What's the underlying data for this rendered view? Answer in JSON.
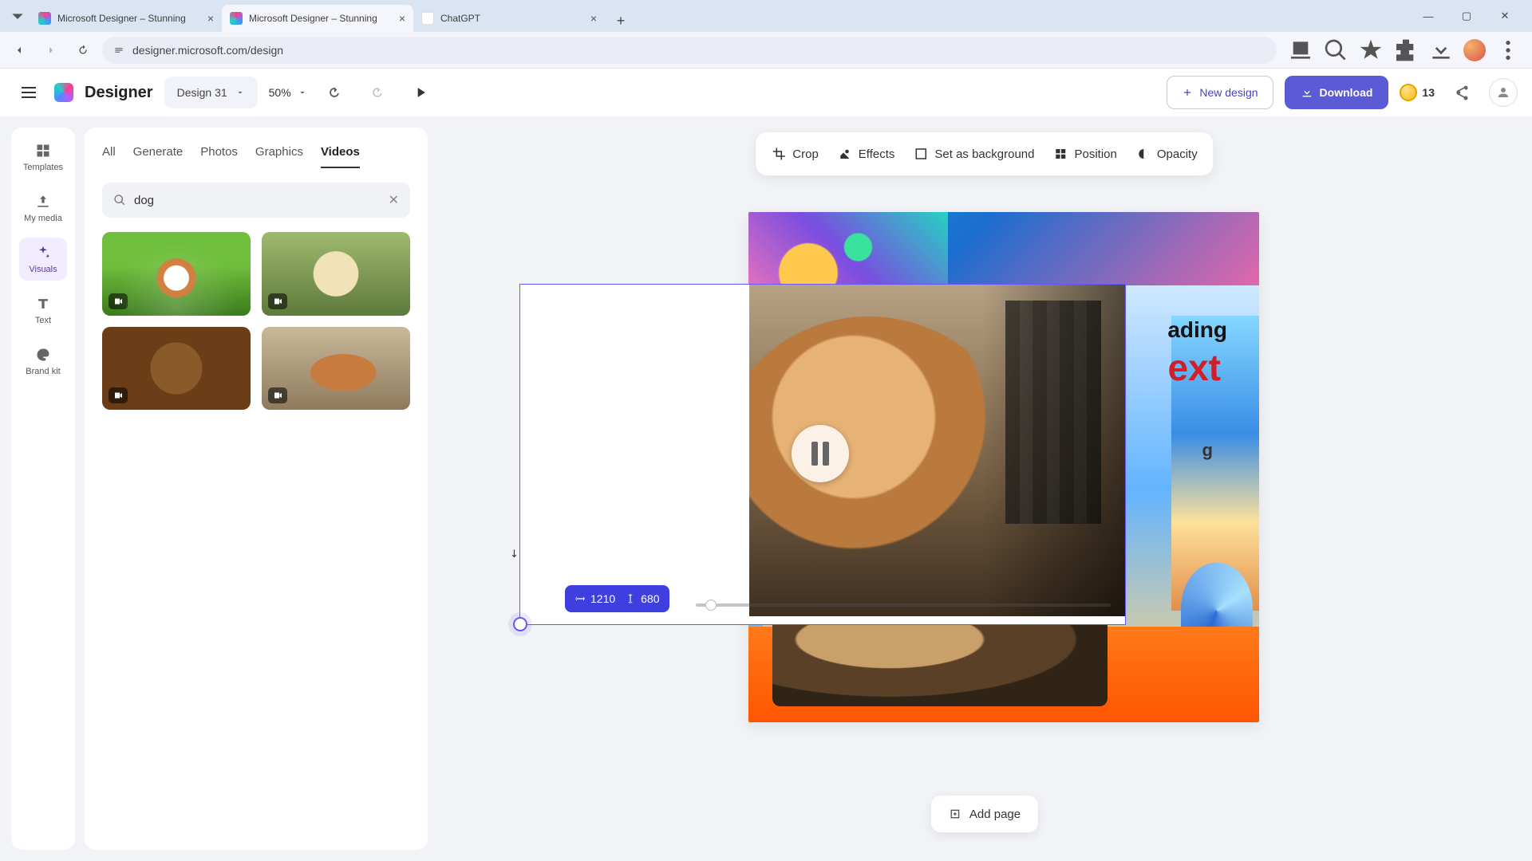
{
  "browser": {
    "tabs": [
      {
        "title": "Microsoft Designer – Stunning"
      },
      {
        "title": "Microsoft Designer – Stunning"
      },
      {
        "title": "ChatGPT"
      }
    ],
    "url": "designer.microsoft.com/design"
  },
  "app": {
    "name": "Designer",
    "project": "Design 31",
    "zoom": "50%",
    "new_design": "New design",
    "download": "Download",
    "credits": "13"
  },
  "rail": {
    "templates": "Templates",
    "mymedia": "My media",
    "visuals": "Visuals",
    "text": "Text",
    "brandkit": "Brand kit"
  },
  "side": {
    "tabs": {
      "all": "All",
      "generate": "Generate",
      "photos": "Photos",
      "graphics": "Graphics",
      "videos": "Videos"
    },
    "search_value": "dog"
  },
  "context": {
    "crop": "Crop",
    "effects": "Effects",
    "setbg": "Set as background",
    "position": "Position",
    "opacity": "Opacity"
  },
  "canvas": {
    "heading_partial": "ading",
    "text_partial": "ext",
    "body_partial": "g",
    "selection": {
      "width": "1210",
      "height": "680"
    },
    "addpage": "Add page"
  }
}
